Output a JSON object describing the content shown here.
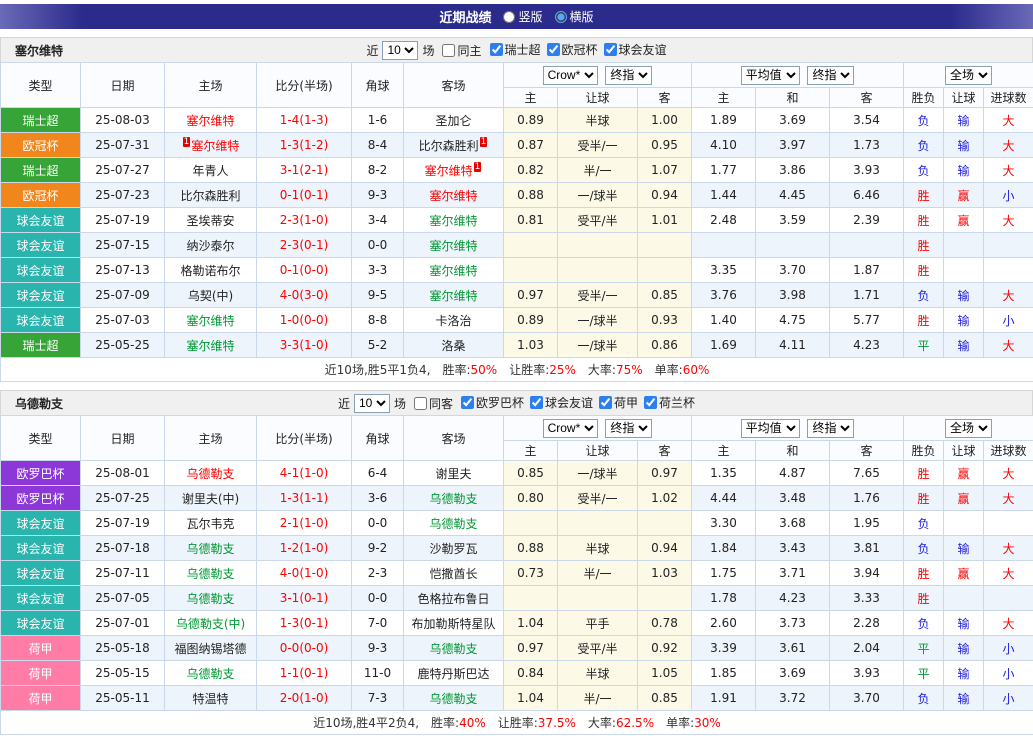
{
  "topbar": {
    "title": "近期战绩",
    "options": [
      {
        "label": "竖版",
        "checked": false
      },
      {
        "label": "横版",
        "checked": true
      }
    ]
  },
  "table_header": {
    "type": "类型",
    "date": "日期",
    "home": "主场",
    "score": "比分(半场)",
    "corner": "角球",
    "away": "客场",
    "odds_selects": [
      "Crow*",
      "终指"
    ],
    "avg_selects": [
      "平均值",
      "终指"
    ],
    "full_selects": [
      "全场"
    ],
    "sub": [
      "主",
      "让球",
      "客",
      "主",
      "和",
      "客",
      "胜负",
      "让球",
      "进球数"
    ]
  },
  "league_colors": {
    "瑞士超": "#36a436",
    "欧冠杯": "#f0861c",
    "球会友谊": "#2ab4ae",
    "欧罗巴杯": "#8c38d9",
    "荷甲": "#ff7ca6"
  },
  "result_colors": {
    "胜": "#ff0000",
    "负": "#1c1cdc",
    "平": "#009933",
    "赢": "#ff0000",
    "输": "#1c1cdc",
    "大": "#ff0000",
    "小": "#1c1cdc"
  },
  "focal_colors": {
    "r": "#ff0000",
    "g": "#009933"
  },
  "sections": [
    {
      "team": "塞尔维特",
      "filter": {
        "near": "近",
        "count": "10",
        "unit": "场",
        "venue": {
          "label": "同主",
          "checked": false
        },
        "leagues": [
          {
            "label": "瑞士超",
            "checked": true
          },
          {
            "label": "欧冠杯",
            "checked": true
          },
          {
            "label": "球会友谊",
            "checked": true
          }
        ]
      },
      "rows": [
        {
          "lg": "瑞士超",
          "date": "25-08-03",
          "home": "塞尔维特",
          "hc": "r",
          "score": "1-4(1-3)",
          "cnr": "1-6",
          "away": "圣加仑",
          "o": [
            "0.89",
            "半球",
            "1.00"
          ],
          "a": [
            "1.89",
            "3.69",
            "3.54"
          ],
          "r": [
            "负",
            "输",
            "大"
          ]
        },
        {
          "lg": "欧冠杯",
          "date": "25-07-31",
          "home": "塞尔维特",
          "hc": "r",
          "hcard": "1",
          "score": "1-3(1-2)",
          "cnr": "8-4",
          "away": "比尔森胜利",
          "acard": "1",
          "o": [
            "0.87",
            "受半/一",
            "0.95"
          ],
          "a": [
            "4.10",
            "3.97",
            "1.73"
          ],
          "r": [
            "负",
            "输",
            "大"
          ]
        },
        {
          "lg": "瑞士超",
          "date": "25-07-27",
          "home": "年青人",
          "score": "3-1(2-1)",
          "cnr": "8-2",
          "away": "塞尔维特",
          "ac": "r",
          "acard": "1",
          "o": [
            "0.82",
            "半/一",
            "1.07"
          ],
          "a": [
            "1.77",
            "3.86",
            "3.93"
          ],
          "r": [
            "负",
            "输",
            "大"
          ]
        },
        {
          "lg": "欧冠杯",
          "date": "25-07-23",
          "home": "比尔森胜利",
          "score": "0-1(0-1)",
          "cnr": "9-3",
          "away": "塞尔维特",
          "ac": "r",
          "o": [
            "0.88",
            "一/球半",
            "0.94"
          ],
          "a": [
            "1.44",
            "4.45",
            "6.46"
          ],
          "r": [
            "胜",
            "赢",
            "小"
          ]
        },
        {
          "lg": "球会友谊",
          "date": "25-07-19",
          "home": "圣埃蒂安",
          "score": "2-3(1-0)",
          "cnr": "3-4",
          "away": "塞尔维特",
          "ac": "g",
          "o": [
            "0.81",
            "受平/半",
            "1.01"
          ],
          "a": [
            "2.48",
            "3.59",
            "2.39"
          ],
          "r": [
            "胜",
            "赢",
            "大"
          ]
        },
        {
          "lg": "球会友谊",
          "date": "25-07-15",
          "home": "纳沙泰尔",
          "score": "2-3(0-1)",
          "cnr": "0-0",
          "away": "塞尔维特",
          "ac": "g",
          "o": [
            "",
            "",
            ""
          ],
          "a": [
            "",
            "",
            ""
          ],
          "r": [
            "胜",
            "",
            ""
          ]
        },
        {
          "lg": "球会友谊",
          "date": "25-07-13",
          "home": "格勒诺布尔",
          "score": "0-1(0-0)",
          "cnr": "3-3",
          "away": "塞尔维特",
          "ac": "g",
          "o": [
            "",
            "",
            ""
          ],
          "a": [
            "3.35",
            "3.70",
            "1.87"
          ],
          "r": [
            "胜",
            "",
            ""
          ]
        },
        {
          "lg": "球会友谊",
          "date": "25-07-09",
          "home": "乌契(中)",
          "score": "4-0(3-0)",
          "cnr": "9-5",
          "away": "塞尔维特",
          "ac": "g",
          "o": [
            "0.97",
            "受半/一",
            "0.85"
          ],
          "a": [
            "3.76",
            "3.98",
            "1.71"
          ],
          "r": [
            "负",
            "输",
            "大"
          ]
        },
        {
          "lg": "球会友谊",
          "date": "25-07-03",
          "home": "塞尔维特",
          "hc": "g",
          "score": "1-0(0-0)",
          "cnr": "8-8",
          "away": "卡洛治",
          "o": [
            "0.89",
            "一/球半",
            "0.93"
          ],
          "a": [
            "1.40",
            "4.75",
            "5.77"
          ],
          "r": [
            "胜",
            "输",
            "小"
          ]
        },
        {
          "lg": "瑞士超",
          "date": "25-05-25",
          "home": "塞尔维特",
          "hc": "g",
          "score": "3-3(1-0)",
          "cnr": "5-2",
          "away": "洛桑",
          "o": [
            "1.03",
            "一/球半",
            "0.86"
          ],
          "a": [
            "1.69",
            "4.11",
            "4.23"
          ],
          "r": [
            "平",
            "输",
            "大"
          ]
        }
      ],
      "summary": {
        "prefix": "近10场,胜5平1负4,",
        "stats": [
          {
            "label": "胜率:",
            "value": "50%"
          },
          {
            "label": "让胜率:",
            "value": "25%"
          },
          {
            "label": "大率:",
            "value": "75%"
          },
          {
            "label": "单率:",
            "value": "60%"
          }
        ]
      }
    },
    {
      "team": "乌德勒支",
      "filter": {
        "near": "近",
        "count": "10",
        "unit": "场",
        "venue": {
          "label": "同客",
          "checked": false
        },
        "leagues": [
          {
            "label": "欧罗巴杯",
            "checked": true
          },
          {
            "label": "球会友谊",
            "checked": true
          },
          {
            "label": "荷甲",
            "checked": true
          },
          {
            "label": "荷兰杯",
            "checked": true
          }
        ]
      },
      "rows": [
        {
          "lg": "欧罗巴杯",
          "date": "25-08-01",
          "home": "乌德勒支",
          "hc": "r",
          "score": "4-1(1-0)",
          "cnr": "6-4",
          "away": "谢里夫",
          "o": [
            "0.85",
            "一/球半",
            "0.97"
          ],
          "a": [
            "1.35",
            "4.87",
            "7.65"
          ],
          "r": [
            "胜",
            "赢",
            "大"
          ]
        },
        {
          "lg": "欧罗巴杯",
          "date": "25-07-25",
          "home": "谢里夫(中)",
          "score": "1-3(1-1)",
          "cnr": "3-6",
          "away": "乌德勒支",
          "ac": "g",
          "o": [
            "0.80",
            "受半/一",
            "1.02"
          ],
          "a": [
            "4.44",
            "3.48",
            "1.76"
          ],
          "r": [
            "胜",
            "赢",
            "大"
          ]
        },
        {
          "lg": "球会友谊",
          "date": "25-07-19",
          "home": "瓦尔韦克",
          "score": "2-1(1-0)",
          "cnr": "0-0",
          "away": "乌德勒支",
          "ac": "g",
          "o": [
            "",
            "",
            ""
          ],
          "a": [
            "3.30",
            "3.68",
            "1.95"
          ],
          "r": [
            "负",
            "",
            ""
          ]
        },
        {
          "lg": "球会友谊",
          "date": "25-07-18",
          "home": "乌德勒支",
          "hc": "g",
          "score": "1-2(1-0)",
          "cnr": "9-2",
          "away": "沙勒罗瓦",
          "o": [
            "0.88",
            "半球",
            "0.94"
          ],
          "a": [
            "1.84",
            "3.43",
            "3.81"
          ],
          "r": [
            "负",
            "输",
            "大"
          ]
        },
        {
          "lg": "球会友谊",
          "date": "25-07-11",
          "home": "乌德勒支",
          "hc": "g",
          "score": "4-0(1-0)",
          "cnr": "2-3",
          "away": "恺撒酋长",
          "o": [
            "0.73",
            "半/一",
            "1.03"
          ],
          "a": [
            "1.75",
            "3.71",
            "3.94"
          ],
          "r": [
            "胜",
            "赢",
            "大"
          ]
        },
        {
          "lg": "球会友谊",
          "date": "25-07-05",
          "home": "乌德勒支",
          "hc": "g",
          "score": "3-1(0-1)",
          "cnr": "0-0",
          "away": "色格拉布鲁日",
          "o": [
            "",
            "",
            ""
          ],
          "a": [
            "1.78",
            "4.23",
            "3.33"
          ],
          "r": [
            "胜",
            "",
            ""
          ]
        },
        {
          "lg": "球会友谊",
          "date": "25-07-01",
          "home": "乌德勒支(中)",
          "hc": "g",
          "score": "1-3(0-1)",
          "cnr": "7-0",
          "away": "布加勒斯特星队",
          "o": [
            "1.04",
            "平手",
            "0.78"
          ],
          "a": [
            "2.60",
            "3.73",
            "2.28"
          ],
          "r": [
            "负",
            "输",
            "大"
          ]
        },
        {
          "lg": "荷甲",
          "date": "25-05-18",
          "home": "福图纳锡塔德",
          "score": "0-0(0-0)",
          "cnr": "9-3",
          "away": "乌德勒支",
          "ac": "g",
          "o": [
            "0.97",
            "受平/半",
            "0.92"
          ],
          "a": [
            "3.39",
            "3.61",
            "2.04"
          ],
          "r": [
            "平",
            "输",
            "小"
          ]
        },
        {
          "lg": "荷甲",
          "date": "25-05-15",
          "home": "乌德勒支",
          "hc": "g",
          "score": "1-1(0-1)",
          "cnr": "11-0",
          "away": "鹿特丹斯巴达",
          "o": [
            "0.84",
            "半球",
            "1.05"
          ],
          "a": [
            "1.85",
            "3.69",
            "3.93"
          ],
          "r": [
            "平",
            "输",
            "小"
          ]
        },
        {
          "lg": "荷甲",
          "date": "25-05-11",
          "home": "特温特",
          "score": "2-0(1-0)",
          "cnr": "7-3",
          "away": "乌德勒支",
          "ac": "g",
          "o": [
            "1.04",
            "半/一",
            "0.85"
          ],
          "a": [
            "1.91",
            "3.72",
            "3.70"
          ],
          "r": [
            "负",
            "输",
            "小"
          ]
        }
      ],
      "summary": {
        "prefix": "近10场,胜4平2负4,",
        "stats": [
          {
            "label": "胜率:",
            "value": "40%"
          },
          {
            "label": "让胜率:",
            "value": "37.5%"
          },
          {
            "label": "大率:",
            "value": "62.5%"
          },
          {
            "label": "单率:",
            "value": "30%"
          }
        ]
      }
    }
  ]
}
